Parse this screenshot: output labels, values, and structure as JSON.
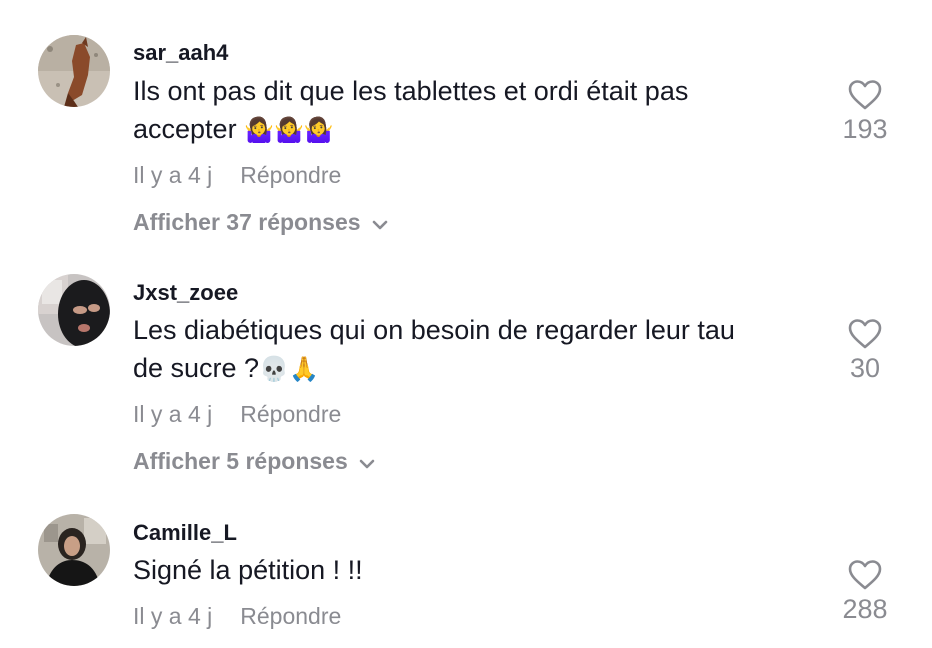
{
  "comments": [
    {
      "username": "sar_aah4",
      "text_line1": "Ils ont pas dit que les tablettes et ordi était pas",
      "text_line2": "accepter",
      "emojis": "🤷‍♀️🤷‍♀️🤷‍♀️",
      "time": "Il y a 4 j",
      "reply_label": "Répondre",
      "replies_label": "Afficher 37 réponses",
      "likes": "193",
      "avatar_icon": "horse-avatar"
    },
    {
      "username": "Jxst_zoee",
      "text_line1": "Les diabétiques qui on besoin de regarder leur tau",
      "text_line2": "de sucre ?",
      "emojis": "💀🙏",
      "time": "Il y a 4 j",
      "reply_label": "Répondre",
      "replies_label": "Afficher 5 réponses",
      "likes": "30",
      "avatar_icon": "balaclava-avatar"
    },
    {
      "username": "Camille_L",
      "text_line1": "Signé la pétition ! !!",
      "time": "Il y a 4 j",
      "reply_label": "Répondre",
      "likes": "288",
      "avatar_icon": "person-avatar"
    }
  ],
  "colors": {
    "text": "#161823",
    "muted": "#8a8b91"
  },
  "icons": {
    "like": "heart-outline-icon",
    "expand": "chevron-down-icon"
  }
}
